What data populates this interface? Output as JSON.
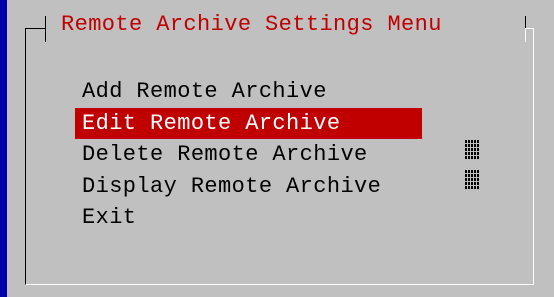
{
  "dialog": {
    "title": "Remote Archive Settings Menu"
  },
  "menu": {
    "items": [
      {
        "label": "Add Remote Archive",
        "selected": false
      },
      {
        "label": "Edit Remote Archive",
        "selected": true
      },
      {
        "label": "Delete Remote Archive",
        "selected": false
      },
      {
        "label": "Display Remote Archive",
        "selected": false
      },
      {
        "label": "Exit",
        "selected": false
      }
    ]
  },
  "colors": {
    "background": "#0000a8",
    "dialog": "#c0c0c0",
    "title": "#c00000",
    "highlight": "#c00000",
    "highlight_text": "#ffffff"
  },
  "icons": {
    "scrollbar": "scroll-indicator-icon"
  }
}
